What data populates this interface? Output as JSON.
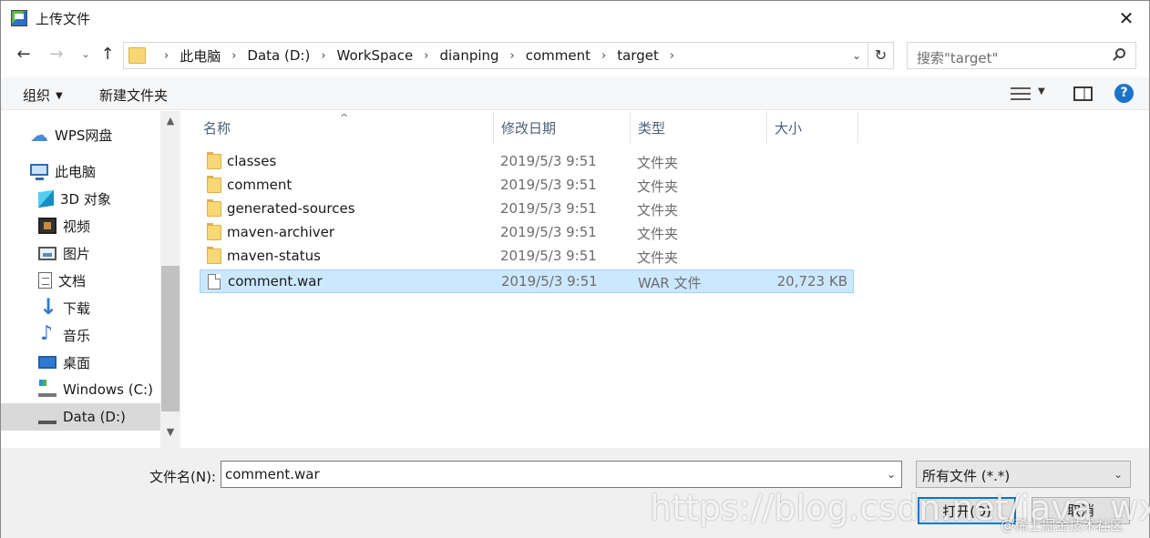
{
  "window": {
    "title": "上传文件",
    "close_glyph": "✕"
  },
  "navigation": {
    "back_glyph": "←",
    "forward_glyph": "→",
    "recent_glyph": "⌄",
    "up_glyph": "↑",
    "breadcrumb": [
      "此电脑",
      "Data (D:)",
      "WorkSpace",
      "dianping",
      "comment",
      "target"
    ],
    "separator": "›",
    "refresh_glyph": "↻",
    "search_placeholder": "搜索\"target\""
  },
  "commandbar": {
    "organize_label": "组织",
    "new_folder_label": "新建文件夹",
    "help_glyph": "?"
  },
  "sidebar": {
    "items": [
      {
        "label": "WPS网盘",
        "icon": "cloud-icon"
      },
      {
        "label": "此电脑",
        "icon": "computer-icon"
      },
      {
        "label": "3D 对象",
        "icon": "3d-objects-icon"
      },
      {
        "label": "视频",
        "icon": "video-icon"
      },
      {
        "label": "图片",
        "icon": "pictures-icon"
      },
      {
        "label": "文档",
        "icon": "documents-icon"
      },
      {
        "label": "下载",
        "icon": "download-icon"
      },
      {
        "label": "音乐",
        "icon": "music-icon"
      },
      {
        "label": "桌面",
        "icon": "desktop-icon"
      },
      {
        "label": "Windows (C:)",
        "icon": "drive-c-icon"
      },
      {
        "label": "Data (D:)",
        "icon": "drive-d-icon",
        "selected": true
      }
    ]
  },
  "filelist": {
    "columns": [
      "名称",
      "修改日期",
      "类型",
      "大小"
    ],
    "rows": [
      {
        "name": "classes",
        "date": "2019/5/3 9:51",
        "type": "文件夹",
        "size": "",
        "kind": "folder"
      },
      {
        "name": "comment",
        "date": "2019/5/3 9:51",
        "type": "文件夹",
        "size": "",
        "kind": "folder"
      },
      {
        "name": "generated-sources",
        "date": "2019/5/3 9:51",
        "type": "文件夹",
        "size": "",
        "kind": "folder"
      },
      {
        "name": "maven-archiver",
        "date": "2019/5/3 9:51",
        "type": "文件夹",
        "size": "",
        "kind": "folder"
      },
      {
        "name": "maven-status",
        "date": "2019/5/3 9:51",
        "type": "文件夹",
        "size": "",
        "kind": "folder"
      },
      {
        "name": "comment.war",
        "date": "2019/5/3 9:51",
        "type": "WAR 文件",
        "size": "20,723 KB",
        "kind": "file",
        "selected": true
      }
    ]
  },
  "footer": {
    "filename_label": "文件名(N):",
    "filename_value": "comment.war",
    "filetype_value": "所有文件 (*.*)",
    "open_label": "打开(O)",
    "cancel_label": "取消"
  },
  "watermark": {
    "url": "https://blog.csdn.net/java_wxid",
    "credit": "@稀土掘金技术社区"
  },
  "colors": {
    "selection_bg": "#cce8ff",
    "selection_border": "#99d1ff",
    "accent": "#0078d7",
    "header_text": "#4c607a"
  }
}
